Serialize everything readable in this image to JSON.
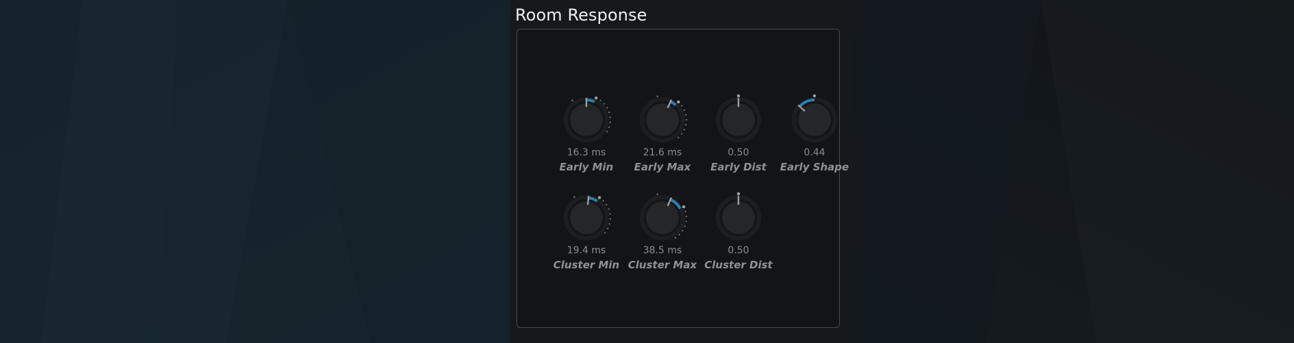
{
  "panel": {
    "title": "Room Response"
  },
  "colors": {
    "accent": "#2d7fb0",
    "knob_body": "#252628",
    "indicator": "#9a9a9a"
  },
  "knobs": [
    {
      "id": "early-min",
      "label": "Early Min",
      "value_text": "16.3 ms",
      "start": 0.5,
      "end": 0.58,
      "mod_ticks": true
    },
    {
      "id": "early-max",
      "label": "Early Max",
      "value_text": "21.6 ms",
      "start": 0.58,
      "end": 0.64,
      "mod_ticks": true
    },
    {
      "id": "early-dist",
      "label": "Early Dist",
      "value_text": "0.50",
      "start": 0.5,
      "end": 0.5,
      "mod_ticks": false
    },
    {
      "id": "early-shape",
      "label": "Early Shape",
      "value_text": "0.44",
      "start": 0.34,
      "end": 0.5,
      "mod_ticks": false
    },
    {
      "id": "cluster-min",
      "label": "Cluster Min",
      "value_text": "19.4 ms",
      "start": 0.52,
      "end": 0.61,
      "mod_ticks": true
    },
    {
      "id": "cluster-max",
      "label": "Cluster Max",
      "value_text": "38.5 ms",
      "start": 0.58,
      "end": 0.71,
      "mod_ticks": true
    },
    {
      "id": "cluster-dist",
      "label": "Cluster Dist",
      "value_text": "0.50",
      "start": 0.5,
      "end": 0.5,
      "mod_ticks": false
    }
  ]
}
